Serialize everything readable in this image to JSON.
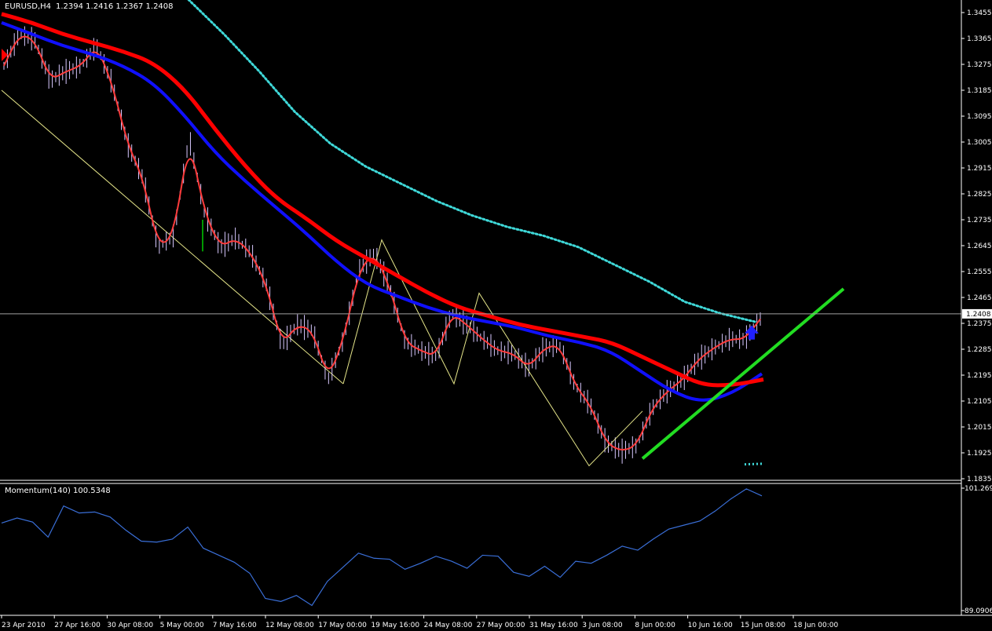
{
  "window": {
    "title": "EURUSD,H4",
    "ohlc": "1.2394 1.2416 1.2367 1.2408"
  },
  "colors": {
    "background": "#000000",
    "axis": "#ffffff",
    "bull_bar": "#00cc00",
    "bar_wick": "#d8c8ff",
    "ema_fast": "#ff3b3b",
    "ema_mid": "#ff0000",
    "ema_slow": "#1010ff",
    "dotted_ma": "#3fd8d8",
    "channel": "#e6e68a",
    "zigzag": "#e6e68a",
    "trendline": "#22dd22",
    "arrow": "#2020ff",
    "momentum": "#3a6fd8",
    "price_line": "#a0a0a0"
  },
  "chart_data": [
    {
      "type": "line",
      "title": "EURUSD,H4",
      "subtitle": "1.2394 1.2416 1.2367 1.2408",
      "x": [
        "23 Apr 2010",
        "27 Apr 16:00",
        "30 Apr 08:00",
        "5 May 00:00",
        "7 May 16:00",
        "12 May 08:00",
        "17 May 00:00",
        "19 May 16:00",
        "24 May 08:00",
        "27 May 00:00",
        "31 May 16:00",
        "3 Jun 08:00",
        "8 Jun 00:00",
        "10 Jun 16:00",
        "15 Jun 08:00",
        "18 Jun 00:00"
      ],
      "ylim": [
        1.1835,
        1.3455
      ],
      "yticks": [
        "1.3455",
        "1.3365",
        "1.3275",
        "1.3185",
        "1.3095",
        "1.3005",
        "1.2915",
        "1.2825",
        "1.2735",
        "1.2645",
        "1.2555",
        "1.2465",
        "1.2375",
        "1.2285",
        "1.2195",
        "1.2105",
        "1.2015",
        "1.1925",
        "1.1835"
      ],
      "current_price": "1.2408",
      "series": [
        {
          "key": "price",
          "values": [
            1.327,
            1.338,
            1.336,
            1.322,
            1.325,
            1.327,
            1.334,
            1.321,
            1.3,
            1.288,
            1.264,
            1.268,
            1.302,
            1.276,
            1.264,
            1.267,
            1.262,
            1.251,
            1.23,
            1.237,
            1.235,
            1.218,
            1.232,
            1.256,
            1.262,
            1.25,
            1.231,
            1.228,
            1.226,
            1.241,
            1.237,
            1.232,
            1.228,
            1.227,
            1.222,
            1.229,
            1.23,
            1.216,
            1.209,
            1.196,
            1.193,
            1.195,
            1.208,
            1.214,
            1.218,
            1.225,
            1.229,
            1.232,
            1.232,
            1.239
          ]
        },
        {
          "key": "ema_red",
          "values": [
            1.345,
            1.342,
            1.338,
            1.335,
            1.332,
            1.328,
            1.319,
            1.305,
            1.292,
            1.281,
            1.274,
            1.266,
            1.26,
            1.254,
            1.248,
            1.243,
            1.24,
            1.237,
            1.235,
            1.233,
            1.231,
            1.226,
            1.221,
            1.216,
            1.216,
            1.218
          ]
        },
        {
          "key": "ema_blue",
          "values": [
            1.342,
            1.338,
            1.334,
            1.331,
            1.327,
            1.321,
            1.31,
            1.297,
            1.287,
            1.278,
            1.269,
            1.259,
            1.251,
            1.247,
            1.243,
            1.24,
            1.238,
            1.236,
            1.233,
            1.231,
            1.228,
            1.221,
            1.214,
            1.21,
            1.213,
            1.22
          ]
        },
        {
          "key": "ma_dotted",
          "values": [
            1.35,
            1.338,
            1.325,
            1.311,
            1.3,
            1.292,
            1.286,
            1.28,
            1.275,
            1.271,
            1.268,
            1.264,
            1.258,
            1.252,
            1.245,
            1.241,
            1.238
          ]
        }
      ],
      "annotations": [
        "descending channel line",
        "zigzag",
        "green trendline",
        "blue up arrow",
        "horizontal line at 1.2408"
      ]
    },
    {
      "type": "line",
      "title": "Momentum(140) 100.5348",
      "ylim": [
        89.0906,
        101.269
      ],
      "yticks": [
        "101.269",
        "89.0906"
      ],
      "series": [
        {
          "key": "momentum",
          "values": [
            97.8,
            98.3,
            97.9,
            96.4,
            99.5,
            98.8,
            98.9,
            98.4,
            97.1,
            96.0,
            95.9,
            96.2,
            97.4,
            95.3,
            94.6,
            93.9,
            92.8,
            90.3,
            90.0,
            90.6,
            89.6,
            92.0,
            93.4,
            94.8,
            94.3,
            94.2,
            93.2,
            93.8,
            94.5,
            94.0,
            93.3,
            94.6,
            94.5,
            92.9,
            92.5,
            93.5,
            92.4,
            94.0,
            93.8,
            94.6,
            95.5,
            95.1,
            96.2,
            97.2,
            97.6,
            98.0,
            99.0,
            100.2,
            101.2,
            100.5
          ]
        }
      ]
    }
  ]
}
